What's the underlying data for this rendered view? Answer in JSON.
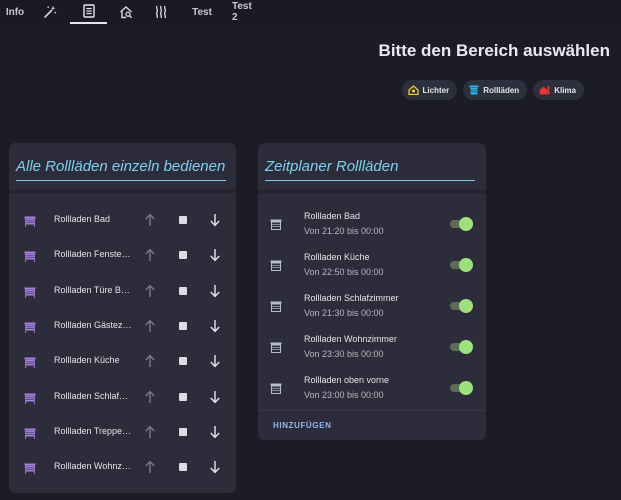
{
  "nav": {
    "tabs": [
      {
        "label": "Info",
        "kind": "text"
      },
      {
        "icon": "magic-wand-icon",
        "kind": "icon"
      },
      {
        "icon": "document-icon",
        "kind": "icon",
        "active": true
      },
      {
        "icon": "home-search-icon",
        "kind": "icon"
      },
      {
        "icon": "heat-wave-icon",
        "kind": "icon"
      },
      {
        "label": "Test",
        "kind": "text"
      },
      {
        "label": "Test 2",
        "kind": "text"
      }
    ]
  },
  "header": {
    "title": "Bitte den Bereich auswählen",
    "chips": [
      {
        "label": "Lichter",
        "icon": "light-house-icon",
        "color": "#f5d547"
      },
      {
        "label": "Rollläden",
        "icon": "blinds-icon",
        "color": "#29b6e8"
      },
      {
        "label": "Klima",
        "icon": "thermometer-home-icon",
        "color": "#e53935"
      }
    ]
  },
  "blinds_card": {
    "title": "Alle Rollläden einzeln bedienen",
    "icon_color": "#a67fe0",
    "rows": [
      {
        "label": "Rollladen Bad"
      },
      {
        "label": "Rollladen Fenster Arbeitszimmer"
      },
      {
        "label": "Rollladen Türe Büro"
      },
      {
        "label": "Rollladen Gästezimmer"
      },
      {
        "label": "Rollladen Küche"
      },
      {
        "label": "Rollladen Schlafzimmer"
      },
      {
        "label": "Rollladen Treppenhaus"
      },
      {
        "label": "Rollladen Wohnzimmer"
      }
    ]
  },
  "schedule_card": {
    "title": "Zeitplaner Rollläden",
    "entries": [
      {
        "name": "Rollladen Bad",
        "time": "Von 21:20 bis 00:00",
        "enabled": true
      },
      {
        "name": "Rollladen Küche",
        "time": "Von 22:50 bis 00:00",
        "enabled": true
      },
      {
        "name": "Rollladen Schlafzimmer",
        "time": "Von 21:30 bis 00:00",
        "enabled": true
      },
      {
        "name": "Rollladen Wohnzimmer",
        "time": "Von 23:30 bis 00:00",
        "enabled": true
      },
      {
        "name": "Rollladen oben vorne",
        "time": "Von 23:00 bis 00:00",
        "enabled": true
      }
    ],
    "add_label": "HINZUFÜGEN"
  }
}
